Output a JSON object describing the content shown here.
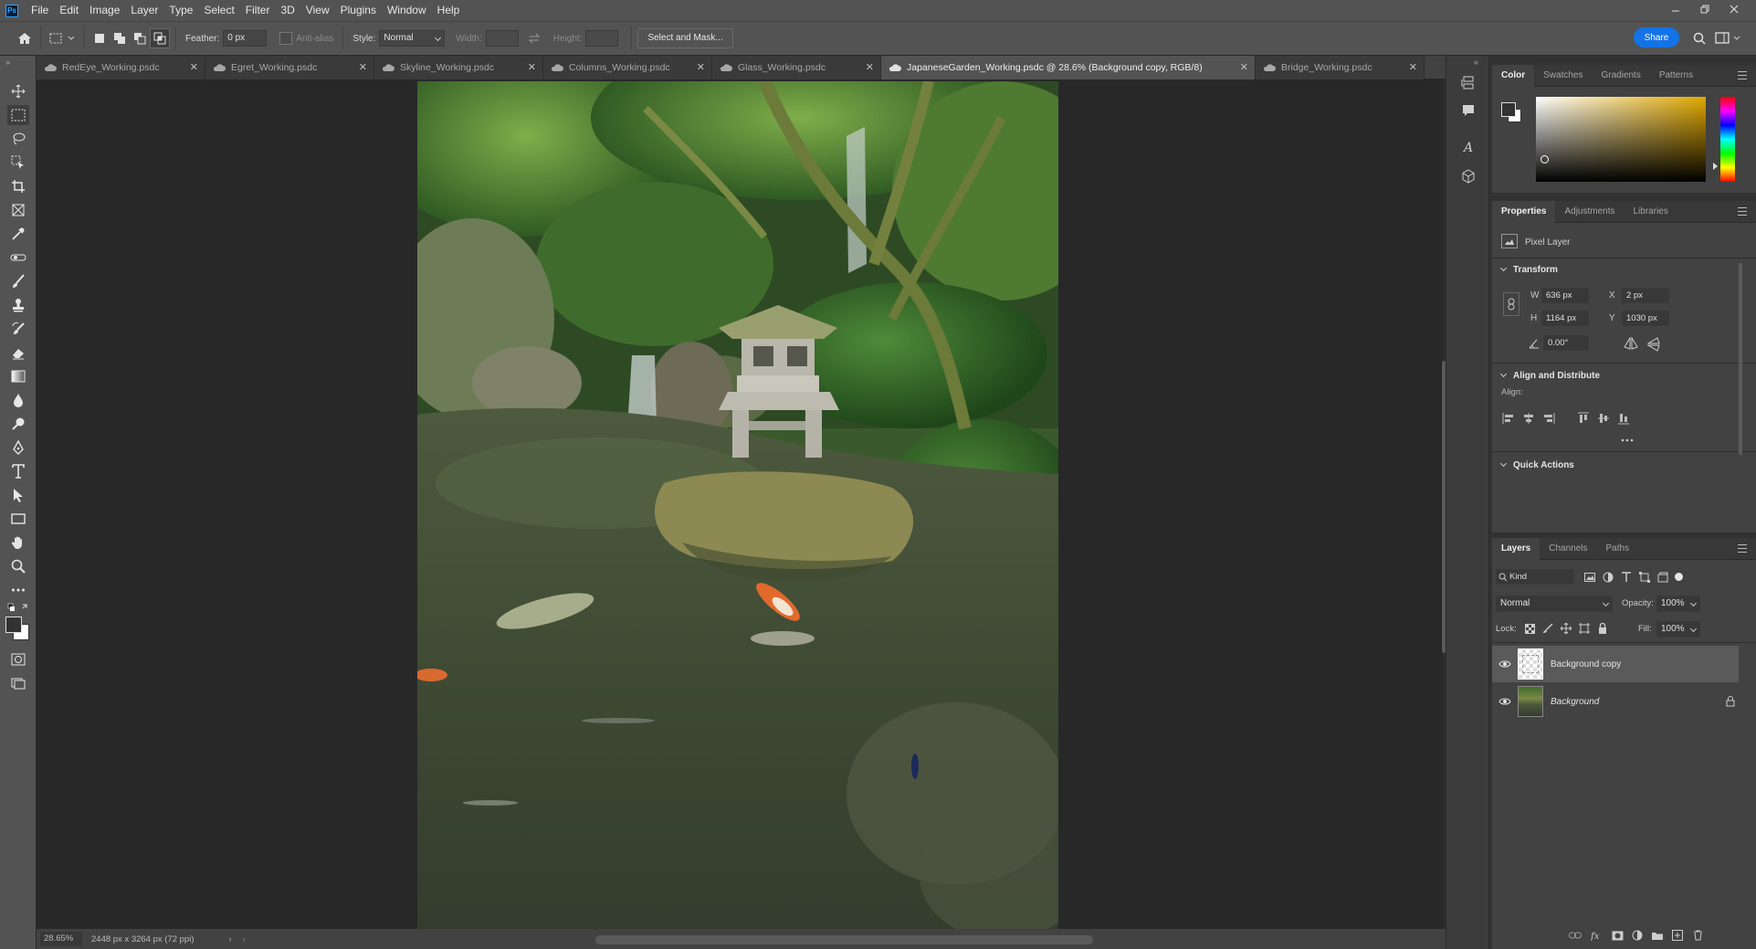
{
  "app": {
    "logo": "Ps"
  },
  "menu": [
    "File",
    "Edit",
    "Image",
    "Layer",
    "Type",
    "Select",
    "Filter",
    "3D",
    "View",
    "Plugins",
    "Window",
    "Help"
  ],
  "options_bar": {
    "feather_label": "Feather:",
    "feather_value": "0 px",
    "antialias_label": "Anti-alias",
    "style_label": "Style:",
    "style_value": "Normal",
    "width_label": "Width:",
    "height_label": "Height:",
    "select_mask_label": "Select and Mask...",
    "share_label": "Share"
  },
  "tabs": [
    {
      "label": "RedEye_Working.psdc",
      "active": false
    },
    {
      "label": "Egret_Working.psdc",
      "active": false
    },
    {
      "label": "Skyline_Working.psdc",
      "active": false
    },
    {
      "label": "Columns_Working.psdc",
      "active": false
    },
    {
      "label": "Glass_Working.psdc",
      "active": false
    },
    {
      "label": "JapaneseGarden_Working.psdc @ 28.6% (Background copy, RGB/8)",
      "active": true
    },
    {
      "label": "Bridge_Working.psdc",
      "active": false
    }
  ],
  "status": {
    "zoom": "28.65%",
    "doc_info": "2448 px x 3264 px (72 ppi)"
  },
  "color_panel": {
    "tabs": [
      "Color",
      "Swatches",
      "Gradients",
      "Patterns"
    ],
    "foreground": "#333333",
    "background": "#ffffff",
    "hue_color": "#e0a800"
  },
  "properties_panel": {
    "tabs": [
      "Properties",
      "Adjustments",
      "Libraries"
    ],
    "layer_type": "Pixel Layer",
    "transform_title": "Transform",
    "w_label": "W",
    "w_value": "636 px",
    "x_label": "X",
    "x_value": "2 px",
    "h_label": "H",
    "h_value": "1164 px",
    "y_label": "Y",
    "y_value": "1030 px",
    "angle_value": "0.00°",
    "align_title": "Align and Distribute",
    "align_label": "Align:",
    "quick_actions_title": "Quick Actions"
  },
  "layers_panel": {
    "tabs": [
      "Layers",
      "Channels",
      "Paths"
    ],
    "filter_kind": "Kind",
    "blend_mode": "Normal",
    "opacity_label": "Opacity:",
    "opacity_value": "100%",
    "lock_label": "Lock:",
    "fill_label": "Fill:",
    "fill_value": "100%",
    "layers": [
      {
        "name": "Background copy",
        "selected": true,
        "locked": false
      },
      {
        "name": "Background",
        "selected": false,
        "locked": true
      }
    ]
  },
  "tools": [
    "move-tool",
    "marquee-tool",
    "lasso-tool",
    "object-selection-tool",
    "crop-tool",
    "frame-tool",
    "eyedropper-tool",
    "healing-brush-tool",
    "brush-tool",
    "clone-stamp-tool",
    "history-brush-tool",
    "eraser-tool",
    "gradient-tool",
    "blur-tool",
    "dodge-tool",
    "pen-tool",
    "type-tool",
    "path-selection-tool",
    "rectangle-tool",
    "hand-tool",
    "zoom-tool",
    "edit-toolbar"
  ]
}
